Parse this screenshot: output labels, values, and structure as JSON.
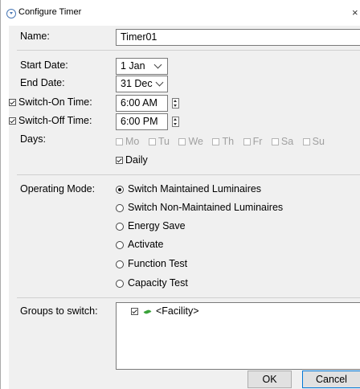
{
  "window": {
    "title": "Configure Timer",
    "close_label": "×"
  },
  "form": {
    "name_label": "Name:",
    "name_value": "Timer01",
    "start_date_label": "Start Date:",
    "start_date_value": "1 Jan",
    "end_date_label": "End Date:",
    "end_date_value": "31 Dec",
    "switch_on_label": "Switch-On Time:",
    "switch_on_value": "6:00 AM",
    "switch_on_checked": true,
    "switch_off_label": "Switch-Off Time:",
    "switch_off_value": "6:00 PM",
    "switch_off_checked": true,
    "days_label": "Days:",
    "days": [
      "Mo",
      "Tu",
      "We",
      "Th",
      "Fr",
      "Sa",
      "Su"
    ],
    "daily_label": "Daily",
    "daily_checked": true
  },
  "mode": {
    "label": "Operating Mode:",
    "options": [
      "Switch Maintained Luminaires",
      "Switch Non-Maintained Luminaires",
      "Energy Save",
      "Activate",
      "Function Test",
      "Capacity Test"
    ],
    "selected_index": 0
  },
  "groups": {
    "label": "Groups to switch:",
    "items": [
      {
        "label": "<Facility>",
        "checked": true,
        "icon": "leaf-icon"
      }
    ]
  },
  "buttons": {
    "ok": "OK",
    "cancel": "Cancel"
  }
}
